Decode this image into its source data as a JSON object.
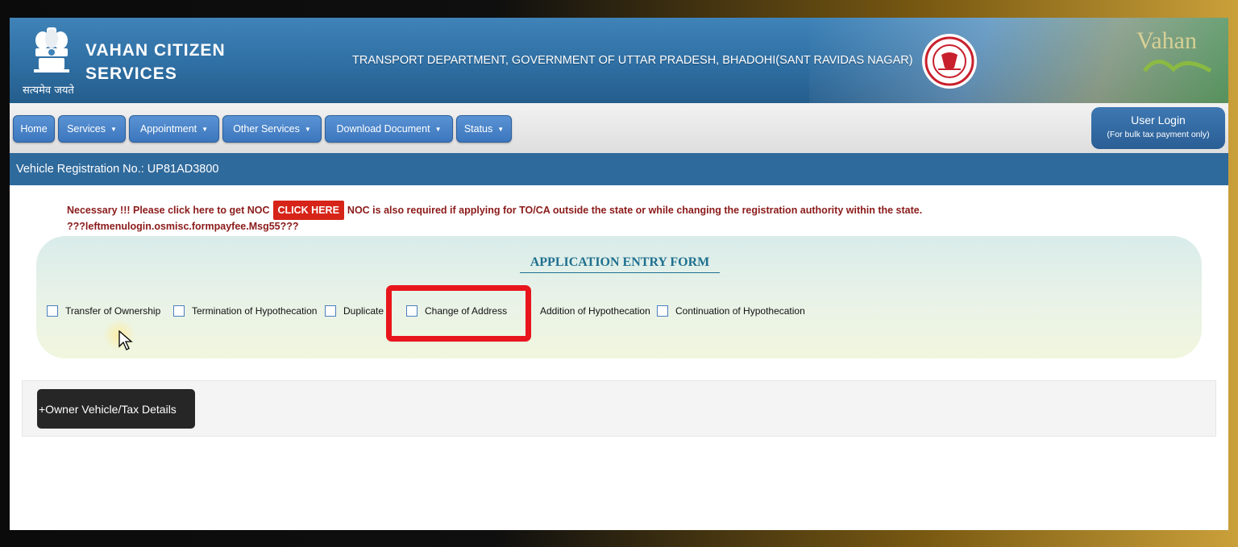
{
  "header": {
    "app_title": "VAHAN CITIZEN SERVICES",
    "emblem_caption": "सत्यमेव जयते",
    "department": "TRANSPORT DEPARTMENT, GOVERNMENT OF UTTAR PRADESH, BHADOHI(SANT RAVIDAS NAGAR)",
    "brand_logo_text": "Vahan"
  },
  "nav": {
    "items": [
      {
        "label": "Home",
        "dropdown": false
      },
      {
        "label": "Services",
        "dropdown": true
      },
      {
        "label": "Appointment",
        "dropdown": true
      },
      {
        "label": "Other Services",
        "dropdown": true
      },
      {
        "label": "Download Document",
        "dropdown": true
      },
      {
        "label": "Status",
        "dropdown": true
      }
    ],
    "login_label": "User Login",
    "login_sub": "(For bulk tax payment only)"
  },
  "reg_bar": {
    "text": "Vehicle Registration No.: UP81AD3800"
  },
  "notice": {
    "prefix": "Necessary !!! Please click here to get NOC",
    "button": "CLICK HERE",
    "suffix": "NOC is also required if applying for TO/CA outside the state or while changing the registration authority within the state.",
    "msg_key": "???leftmenulogin.osmisc.formpayfee.Msg55???"
  },
  "form": {
    "title": "APPLICATION ENTRY FORM",
    "options": [
      {
        "label": "Transfer of Ownership",
        "checked": false
      },
      {
        "label": "Termination of Hypothecation",
        "checked": false
      },
      {
        "label": "Duplicate",
        "checked": false
      },
      {
        "label": "Change of Address",
        "checked": false
      },
      {
        "label": "Addition of Hypothecation",
        "checked": false
      },
      {
        "label": "Continuation of Hypothecation",
        "checked": false
      }
    ]
  },
  "details": {
    "owner_button": "+Owner Vehicle/Tax Details"
  },
  "colors": {
    "header_blue": "#2f6fa3",
    "nav_button": "#3c76bd",
    "notice_red": "#8b1a1a",
    "click_here_red": "#d62418",
    "highlight_red": "#e8161c",
    "form_title": "#1f6f8f"
  }
}
